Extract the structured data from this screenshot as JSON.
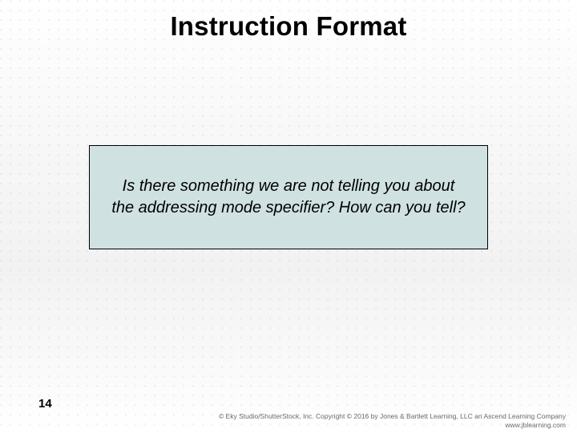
{
  "slide": {
    "title": "Instruction Format",
    "callout_text": "Is there something we are not telling you about the addressing mode specifier? How can you tell?",
    "page_number": "14"
  },
  "footer": {
    "copyright": "© Eky Studio/ShutterStock, Inc. Copyright © 2016 by Jones & Bartlett Learning, LLC an Ascend Learning Company",
    "url": "www.jblearning.com"
  }
}
